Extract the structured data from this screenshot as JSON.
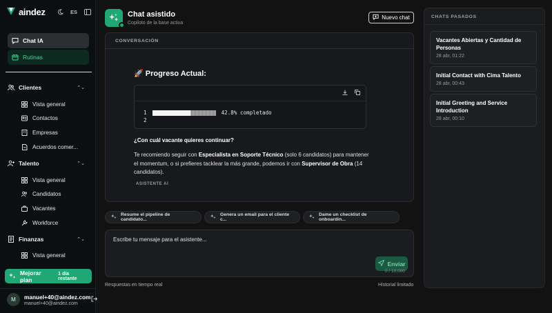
{
  "brand": {
    "logo_text": "aindez",
    "lang": "ES",
    "accent": "#1fa876"
  },
  "sidebar": {
    "chat_ia": "Chat IA",
    "rutinas": "Rutinas",
    "groups": [
      {
        "label": "Clientes",
        "items": [
          "Vista general",
          "Contactos",
          "Empresas",
          "Acuerdos comer..."
        ]
      },
      {
        "label": "Talento",
        "items": [
          "Vista general",
          "Candidatos",
          "Vacantes",
          "Workforce"
        ]
      },
      {
        "label": "Finanzas",
        "items": [
          "Vista general"
        ]
      }
    ],
    "upgrade_label": "Mejorar plan",
    "upgrade_days": "1 día restante",
    "user_initial": "M",
    "user_name": "manuel+40@aindez.com",
    "user_email": "manuel+40@aindez.com"
  },
  "header": {
    "title": "Chat asistido",
    "subtitle": "Copiloto de la base activa",
    "new_chat": "Nuevo chat"
  },
  "conversation": {
    "label": "CONVERSACIÓN",
    "message_title": "🚀 Progreso Actual:",
    "code": {
      "line1_num": "1",
      "line2_num": "2",
      "progress": 0.428,
      "progress_text": "42.8% completado"
    },
    "question": "¿Con cuál vacante quieres continuar?",
    "para_1": "Te recomiendo seguir con ",
    "para_bold_1": "Especialista en Soporte Técnico",
    "para_2": " (solo 6 candidatos) para mantener el momentum, o si prefieres tacklear la más grande, podemos ir con ",
    "para_bold_2": "Supervisor de Obra",
    "para_3": " (14 candidatos).",
    "author": "ASISTENTE AI"
  },
  "suggestions": [
    "Resume el pipeline de candidato...",
    "Genera un email para el cliente c...",
    "Dame un checklist de onboardin..."
  ],
  "composer": {
    "placeholder": "Escribe tu mensaje para el asistente...",
    "send": "Enviar",
    "counter": "0 / 10,000",
    "footer_left": "Respuestas en tiempo real",
    "footer_right": "Historial limitado"
  },
  "past_chats": {
    "label": "CHATS PASADOS",
    "items": [
      {
        "title": "Vacantes Abiertas y Cantidad de Personas",
        "date": "28 abr, 01:22"
      },
      {
        "title": "Initial Contact with Cima Talento",
        "date": "28 abr, 00:43"
      },
      {
        "title": "Initial Greeting and Service Introduction",
        "date": "28 abr, 00:10"
      }
    ]
  }
}
